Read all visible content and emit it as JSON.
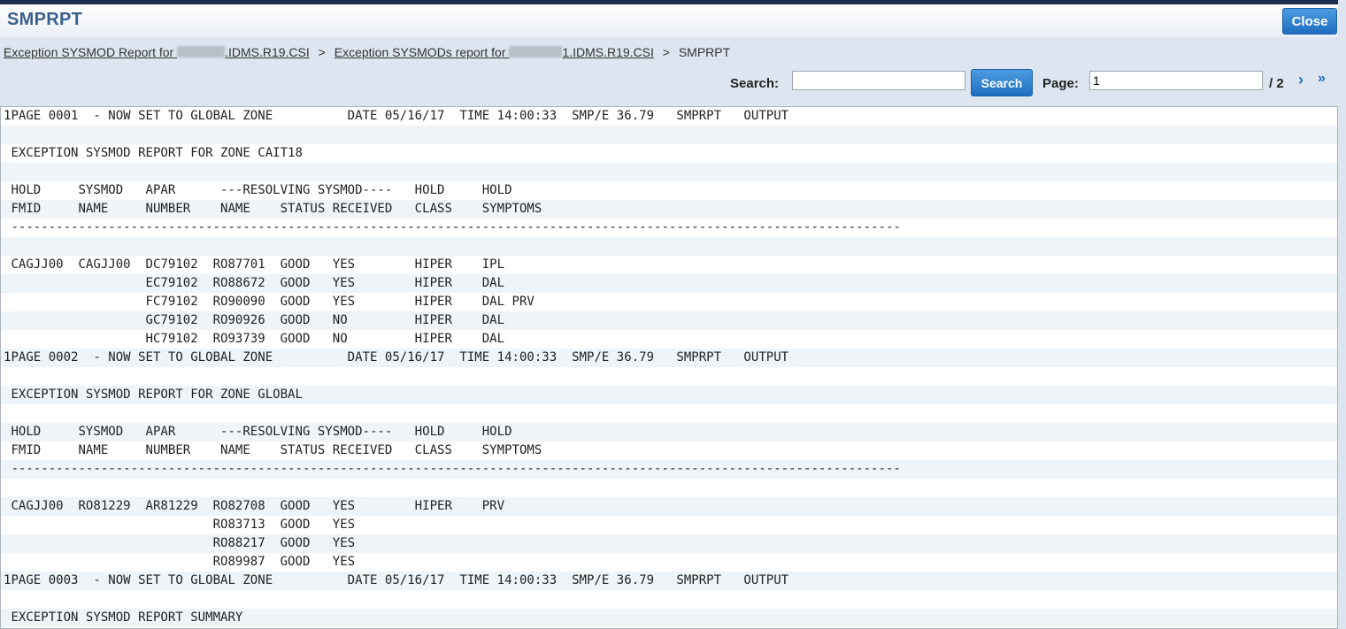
{
  "window": {
    "title": "SMPRPT",
    "close_label": "Close"
  },
  "breadcrumb": {
    "crumb1_prefix": "Exception SYSMOD Report for ",
    "crumb1_suffix": ".IDMS.R19.CSI",
    "crumb2_prefix": "Exception SYSMODs report for ",
    "crumb2_suffix": "1.IDMS.R19.CSI",
    "current": "SMPRPT",
    "separator": ">"
  },
  "toolbar": {
    "search_label": "Search:",
    "search_value": "",
    "search_button": "Search",
    "page_label": "Page:",
    "page_value": "1",
    "page_total": "/ 2",
    "next_glyph": "›",
    "last_glyph": "»"
  },
  "report_lines": [
    "1PAGE 0001  - NOW SET TO GLOBAL ZONE          DATE 05/16/17  TIME 14:00:33  SMP/E 36.79   SMPRPT   OUTPUT",
    "",
    " EXCEPTION SYSMOD REPORT FOR ZONE CAIT18",
    "",
    " HOLD     SYSMOD   APAR      ---RESOLVING SYSMOD----   HOLD     HOLD",
    " FMID     NAME     NUMBER    NAME    STATUS RECEIVED   CLASS    SYMPTOMS",
    " -----------------------------------------------------------------------------------------------------------------------",
    "",
    " CAGJJ00  CAGJJ00  DC79102  RO87701  GOOD   YES        HIPER    IPL",
    "                   EC79102  RO88672  GOOD   YES        HIPER    DAL",
    "                   FC79102  RO90090  GOOD   YES        HIPER    DAL PRV",
    "                   GC79102  RO90926  GOOD   NO         HIPER    DAL",
    "                   HC79102  RO93739  GOOD   NO         HIPER    DAL",
    "1PAGE 0002  - NOW SET TO GLOBAL ZONE          DATE 05/16/17  TIME 14:00:33  SMP/E 36.79   SMPRPT   OUTPUT",
    "",
    " EXCEPTION SYSMOD REPORT FOR ZONE GLOBAL",
    "",
    " HOLD     SYSMOD   APAR      ---RESOLVING SYSMOD----   HOLD     HOLD",
    " FMID     NAME     NUMBER    NAME    STATUS RECEIVED   CLASS    SYMPTOMS",
    " -----------------------------------------------------------------------------------------------------------------------",
    "",
    " CAGJJ00  RO81229  AR81229  RO82708  GOOD   YES        HIPER    PRV",
    "                            RO83713  GOOD   YES",
    "                            RO88217  GOOD   YES",
    "                            RO89987  GOOD   YES",
    "1PAGE 0003  - NOW SET TO GLOBAL ZONE          DATE 05/16/17  TIME 14:00:33  SMP/E 36.79   SMPRPT   OUTPUT",
    "",
    " EXCEPTION SYSMOD REPORT SUMMARY"
  ]
}
